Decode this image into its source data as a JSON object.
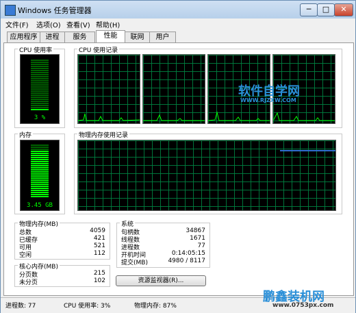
{
  "window": {
    "title": "Windows 任务管理器",
    "buttons": {
      "minimize": "─",
      "maximize": "□",
      "close": "✕"
    }
  },
  "menu": [
    "文件(F)",
    "选项(O)",
    "查看(V)",
    "帮助(H)"
  ],
  "tabs": [
    "应用程序",
    "进程",
    "服务",
    "性能",
    "联网",
    "用户"
  ],
  "active_tab": "性能",
  "cpu": {
    "group_label": "CPU 使用率",
    "value_text": "3 %",
    "level": 0.03,
    "history_label": "CPU 使用记录"
  },
  "memory": {
    "group_label": "内存",
    "value_text": "3.45 GB",
    "level": 0.87,
    "history_label": "物理内存使用记录"
  },
  "physical_memory": {
    "title": "物理内存(MB)",
    "rows": [
      {
        "label": "总数",
        "value": "4059"
      },
      {
        "label": "已缓存",
        "value": "421"
      },
      {
        "label": "可用",
        "value": "521"
      },
      {
        "label": "空闲",
        "value": "112"
      }
    ]
  },
  "kernel_memory": {
    "title": "核心内存(MB)",
    "rows": [
      {
        "label": "分页数",
        "value": "215"
      },
      {
        "label": "未分页",
        "value": "102"
      }
    ]
  },
  "system": {
    "title": "系统",
    "rows": [
      {
        "label": "句柄数",
        "value": "34867"
      },
      {
        "label": "线程数",
        "value": "1671"
      },
      {
        "label": "进程数",
        "value": "77"
      },
      {
        "label": "开机时间",
        "value": "0:14:05:15"
      },
      {
        "label": "提交(MB)",
        "value": "4980 / 8117"
      }
    ]
  },
  "resource_monitor_button": "资源监视器(R)...",
  "status": {
    "processes": "进程数: 77",
    "cpu": "CPU 使用率: 3%",
    "memory": "物理内存: 87%"
  },
  "watermarks": {
    "top_main": "软件自学网",
    "top_url": "WWW.RJZXW.COM",
    "bottom_main": "鹏鑫装机网",
    "bottom_url": "www.0753px.com"
  },
  "colors": {
    "meter_green": "#00ff00",
    "grid_green": "#008040",
    "memory_line": "#2f6fd0",
    "watermark_blue": "#2a8fd8"
  }
}
